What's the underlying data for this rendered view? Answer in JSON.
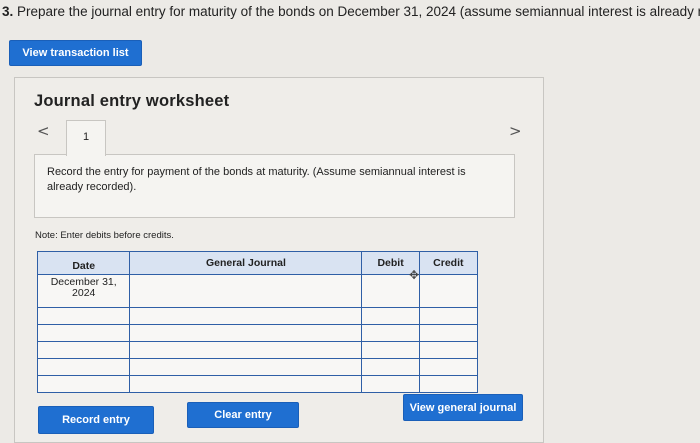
{
  "question": {
    "number": "3.",
    "text": "Prepare the journal entry for maturity of the bonds on December 31, 2024 (assume semiannual interest is already recorded)"
  },
  "buttons": {
    "view_transactions": "View transaction list",
    "record_entry": "Record entry",
    "clear_entry": "Clear entry",
    "view_journal": "View general journal"
  },
  "worksheet": {
    "title": "Journal entry worksheet",
    "nav_prev": "<",
    "nav_next": ">",
    "current_tab": "1",
    "instruction": "Record the entry for payment of the bonds at maturity. (Assume semiannual interest is already recorded).",
    "note": "Note: Enter debits before credits."
  },
  "journal": {
    "headers": {
      "date": "Date",
      "account": "General Journal",
      "debit": "Debit",
      "credit": "Credit"
    },
    "rows": [
      {
        "date": "December 31, 2024",
        "account": "",
        "debit": "",
        "credit": ""
      },
      {
        "date": "",
        "account": "",
        "debit": "",
        "credit": ""
      },
      {
        "date": "",
        "account": "",
        "debit": "",
        "credit": ""
      },
      {
        "date": "",
        "account": "",
        "debit": "",
        "credit": ""
      },
      {
        "date": "",
        "account": "",
        "debit": "",
        "credit": ""
      },
      {
        "date": "",
        "account": "",
        "debit": "",
        "credit": ""
      }
    ]
  },
  "colors": {
    "primary_button": "#1f6fd1",
    "grid_border": "#2f5fa6",
    "header_bg": "#d9e3f2"
  },
  "icons": {
    "prev": "chevron-left-icon",
    "next": "chevron-right-icon",
    "cursor": "move-cursor-icon"
  }
}
